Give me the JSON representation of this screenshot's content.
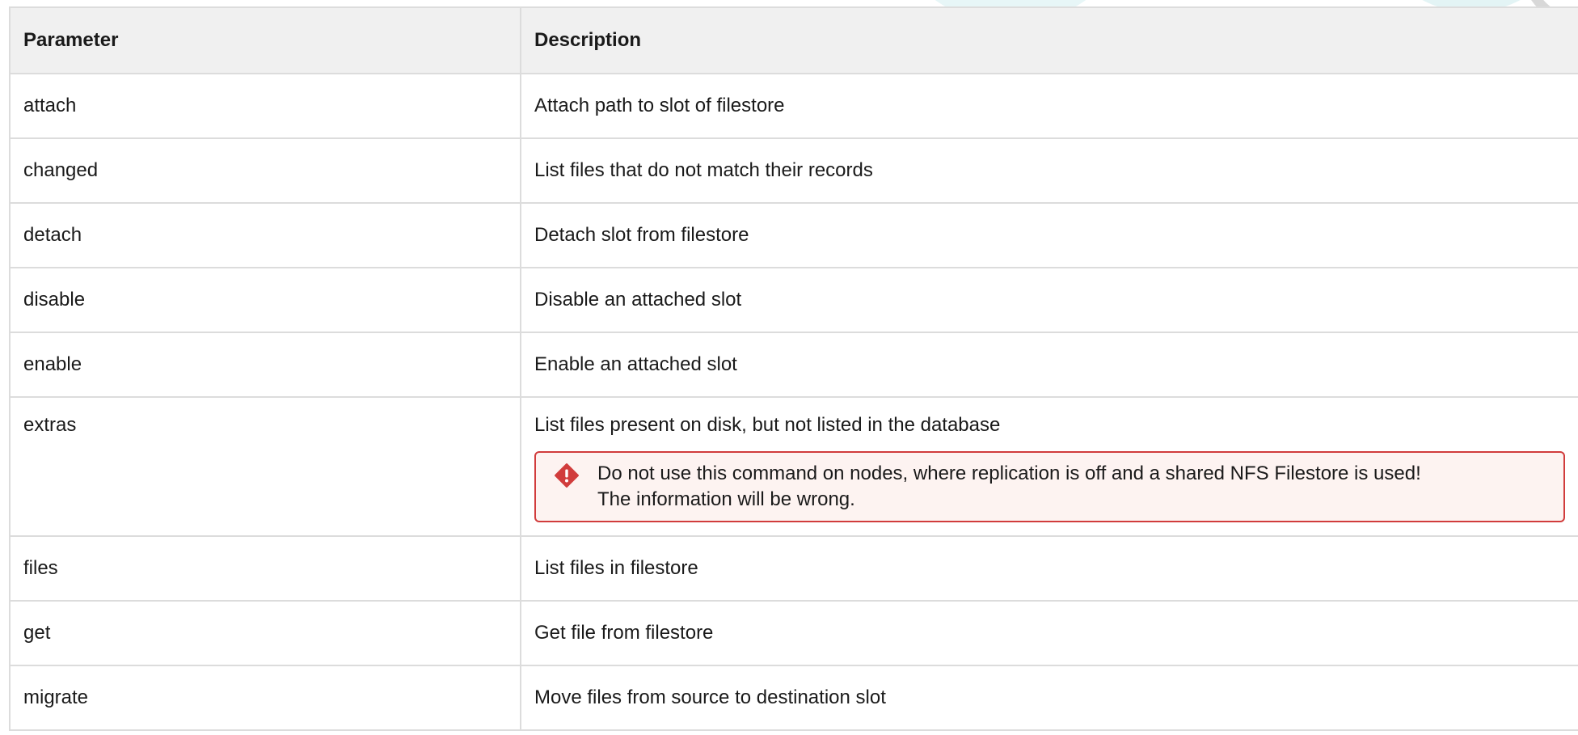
{
  "table": {
    "headers": {
      "parameter": "Parameter",
      "description": "Description"
    },
    "rows": [
      {
        "parameter": "attach",
        "description": "Attach path to slot of filestore"
      },
      {
        "parameter": "changed",
        "description": "List files that do not match their records"
      },
      {
        "parameter": "detach",
        "description": "Detach slot from filestore"
      },
      {
        "parameter": "disable",
        "description": "Disable an attached slot"
      },
      {
        "parameter": "enable",
        "description": "Enable an attached slot"
      },
      {
        "parameter": "extras",
        "description": "List files present on disk, but not listed in the database",
        "alert": {
          "icon": "warning-diamond-icon",
          "line1": "Do not use this command on nodes, where replication is off and a shared NFS Filestore is used!",
          "line2": "The information will be wrong."
        }
      },
      {
        "parameter": "files",
        "description": "List files in filestore"
      },
      {
        "parameter": "get",
        "description": "Get file from filestore"
      },
      {
        "parameter": "migrate",
        "description": "Move files from source to destination slot"
      }
    ]
  },
  "colors": {
    "header_bg": "#f0f0f0",
    "border": "#dcdcdc",
    "alert_border": "#d13c3c",
    "alert_bg": "#fdf3f1",
    "alert_icon": "#d13c3c"
  }
}
